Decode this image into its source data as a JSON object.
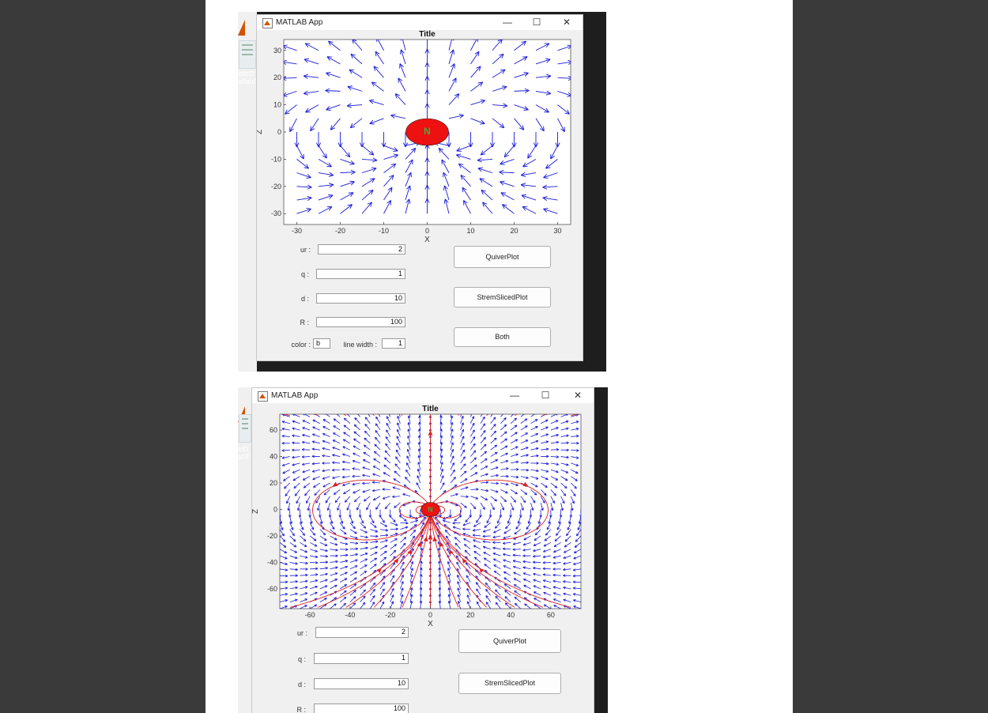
{
  "document": {
    "background": "#3a3a3a",
    "page_color": "#ffffff"
  },
  "colors": {
    "field_arrow": "#1a1ad8",
    "streamline": "#e02020",
    "dipole_fill": "#ee1111",
    "dipole_mark": "#3cb043"
  },
  "screenshots": [
    {
      "background_app_text": [
        "eticD",
        "atlabF"
      ],
      "window": {
        "icon": "matlab-icon",
        "title": "MATLAB App",
        "minimize": "—",
        "maximize": "☐",
        "close": "✕"
      },
      "plot": {
        "chart_data": {
          "type": "quiver",
          "title": "Title",
          "xlabel": "X",
          "ylabel": "Z",
          "xlim": [
            -33,
            33
          ],
          "ylim": [
            -34,
            34
          ],
          "xticks": [
            "-30",
            "-20",
            "-10",
            "0",
            "10",
            "20",
            "30"
          ],
          "yticks": [
            "30",
            "20",
            "10",
            "0",
            "-10",
            "-20",
            "-30"
          ],
          "grid": "off",
          "legend": "none",
          "field": "magnetic dipole",
          "dipole_position": [
            0,
            0
          ],
          "arrow_color": "b",
          "streamlines": false,
          "grid_step": 5
        }
      },
      "form": {
        "ur": {
          "label": "ur :",
          "value": "2"
        },
        "q": {
          "label": "q :",
          "value": "1"
        },
        "d": {
          "label": "d :",
          "value": "10"
        },
        "R": {
          "label": "R :",
          "value": "100"
        },
        "color": {
          "label": "color :",
          "value": "b"
        },
        "line_width": {
          "label": "line width :",
          "value": "1"
        }
      },
      "buttons": {
        "quiver": "QuiverPlot",
        "stream": "StremSlicedPlot",
        "both": "Both"
      }
    },
    {
      "background_app_text": [
        "icD",
        "abF"
      ],
      "window": {
        "icon": "matlab-icon",
        "title": "MATLAB App",
        "minimize": "—",
        "maximize": "☐",
        "close": "✕"
      },
      "plot": {
        "chart_data": {
          "type": "quiver+streamline",
          "title": "Title",
          "xlabel": "X",
          "ylabel": "Z",
          "xlim": [
            -75,
            75
          ],
          "ylim": [
            -75,
            72
          ],
          "xticks": [
            "-60",
            "-40",
            "-20",
            "0",
            "20",
            "40",
            "60"
          ],
          "yticks": [
            "60",
            "40",
            "20",
            "0",
            "-20",
            "-40",
            "-60"
          ],
          "grid": "off",
          "legend": "none",
          "field": "magnetic dipole",
          "dipole_position": [
            0,
            0
          ],
          "arrow_color": "b",
          "streamline_color": "r",
          "streamlines": true,
          "grid_step": 5
        }
      },
      "form": {
        "ur": {
          "label": "ur :",
          "value": "2"
        },
        "q": {
          "label": "q :",
          "value": "1"
        },
        "d": {
          "label": "d :",
          "value": "10"
        },
        "R": {
          "label": "R :",
          "value": "100"
        }
      },
      "buttons": {
        "quiver": "QuiverPlot",
        "stream": "StremSlicedPlot"
      }
    }
  ]
}
